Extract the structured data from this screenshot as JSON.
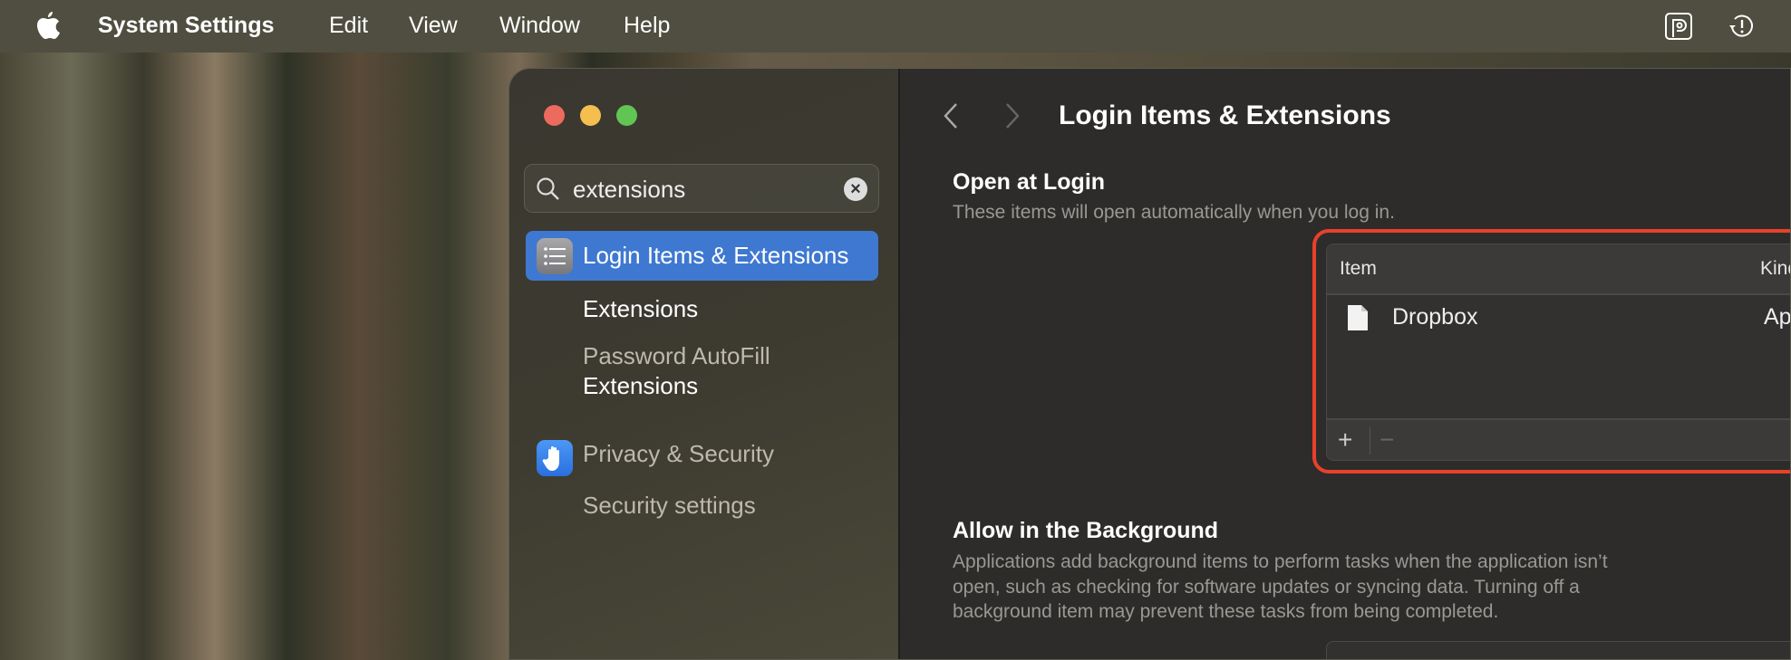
{
  "menubar": {
    "app": "System Settings",
    "items": [
      "Edit",
      "View",
      "Window",
      "Help"
    ],
    "icons": [
      "apple-logo-icon",
      "parking-app-icon",
      "time-machine-icon"
    ]
  },
  "sidebar": {
    "search": {
      "value": "extensions"
    },
    "items": [
      {
        "label": "Login Items & Extensions",
        "selected": true,
        "icon": "list-icon"
      },
      {
        "label": "Extensions"
      },
      {
        "label_line1": "Password AutoFill",
        "label_line2": "Extensions"
      },
      {
        "label": "Privacy & Security",
        "icon": "hand-icon"
      },
      {
        "label": "Security settings"
      }
    ]
  },
  "content": {
    "title": "Login Items & Extensions",
    "open_at_login": {
      "heading": "Open at Login",
      "description": "These items will open automatically when you log in.",
      "columns": [
        "Item",
        "Kind"
      ],
      "rows": [
        {
          "item": "Dropbox",
          "kind": "Application"
        }
      ],
      "add_label": "+",
      "remove_label": "−"
    },
    "background": {
      "heading": "Allow in the Background",
      "description_lines": [
        "Applications add background items to perform tasks when the application isn’t",
        "open, such as checking for software updates or syncing data. Turning off a",
        "background item may prevent these tasks from being completed."
      ]
    }
  },
  "colors": {
    "accent": "#3f78d0",
    "highlight": "#e8412b"
  }
}
